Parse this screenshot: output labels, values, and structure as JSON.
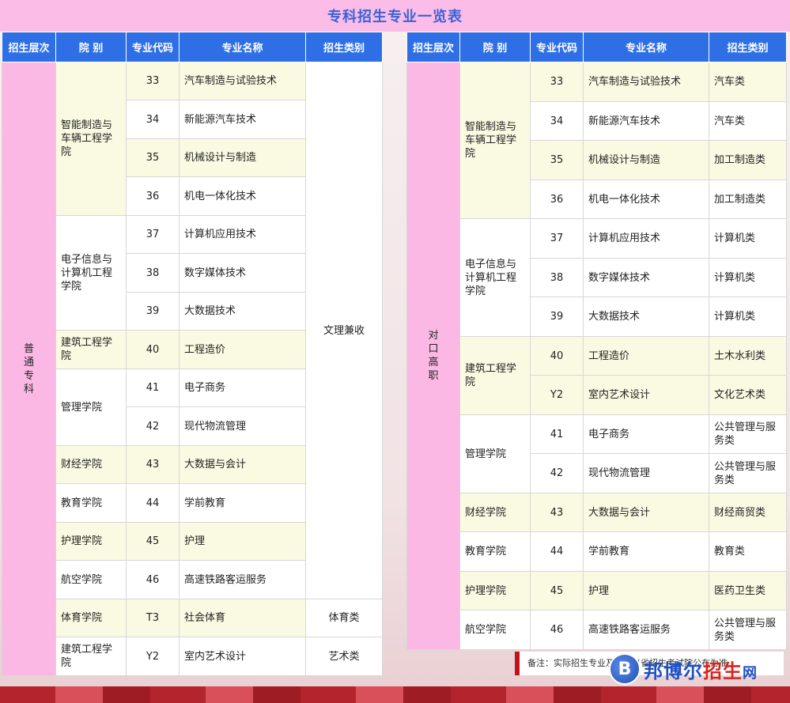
{
  "title": "专科招生专业一览表",
  "headers": [
    "招生层次",
    "院  别",
    "专业代码",
    "专业名称",
    "招生类别"
  ],
  "left": {
    "level": "普通专科",
    "rows": [
      {
        "college": "智能制造与车辆工程学院",
        "code": "33",
        "name": "汽车制造与试验技术",
        "category": "文理兼收"
      },
      {
        "college": "",
        "code": "34",
        "name": "新能源汽车技术",
        "category": ""
      },
      {
        "college": "",
        "code": "35",
        "name": "机械设计与制造",
        "category": ""
      },
      {
        "college": "",
        "code": "36",
        "name": "机电一体化技术",
        "category": ""
      },
      {
        "college": "电子信息与计算机工程学院",
        "code": "37",
        "name": "计算机应用技术",
        "category": ""
      },
      {
        "college": "",
        "code": "38",
        "name": "数字媒体技术",
        "category": ""
      },
      {
        "college": "",
        "code": "39",
        "name": "大数据技术",
        "category": ""
      },
      {
        "college": "建筑工程学院",
        "code": "40",
        "name": "工程造价",
        "category": ""
      },
      {
        "college": "管理学院",
        "code": "41",
        "name": "电子商务",
        "category": ""
      },
      {
        "college": "",
        "code": "42",
        "name": "现代物流管理",
        "category": ""
      },
      {
        "college": "财经学院",
        "code": "43",
        "name": "大数据与会计",
        "category": ""
      },
      {
        "college": "教育学院",
        "code": "44",
        "name": "学前教育",
        "category": ""
      },
      {
        "college": "护理学院",
        "code": "45",
        "name": "护理",
        "category": ""
      },
      {
        "college": "航空学院",
        "code": "46",
        "name": "高速铁路客运服务",
        "category": ""
      },
      {
        "college": "体育学院",
        "code": "T3",
        "name": "社会体育",
        "category": "体育类"
      },
      {
        "college": "建筑工程学院",
        "code": "Y2",
        "name": "室内艺术设计",
        "category": "艺术类"
      }
    ]
  },
  "right": {
    "level": "对口高职",
    "rows": [
      {
        "college": "智能制造与车辆工程学院",
        "code": "33",
        "name": "汽车制造与试验技术",
        "category": "汽车类"
      },
      {
        "college": "",
        "code": "34",
        "name": "新能源汽车技术",
        "category": "汽车类"
      },
      {
        "college": "",
        "code": "35",
        "name": "机械设计与制造",
        "category": "加工制造类"
      },
      {
        "college": "",
        "code": "36",
        "name": "机电一体化技术",
        "category": "加工制造类"
      },
      {
        "college": "电子信息与计算机工程学院",
        "code": "37",
        "name": "计算机应用技术",
        "category": "计算机类"
      },
      {
        "college": "",
        "code": "38",
        "name": "数字媒体技术",
        "category": "计算机类"
      },
      {
        "college": "",
        "code": "39",
        "name": "大数据技术",
        "category": "计算机类"
      },
      {
        "college": "建筑工程学院",
        "code": "40",
        "name": "工程造价",
        "category": "土木水利类"
      },
      {
        "college": "",
        "code": "Y2",
        "name": "室内艺术设计",
        "category": "文化艺术类"
      },
      {
        "college": "管理学院",
        "code": "41",
        "name": "电子商务",
        "category": "公共管理与服务类"
      },
      {
        "college": "",
        "code": "42",
        "name": "现代物流管理",
        "category": "公共管理与服务类"
      },
      {
        "college": "财经学院",
        "code": "43",
        "name": "大数据与会计",
        "category": "财经商贸类"
      },
      {
        "college": "教育学院",
        "code": "44",
        "name": "学前教育",
        "category": "教育类"
      },
      {
        "college": "护理学院",
        "code": "45",
        "name": "护理",
        "category": "医药卫生类"
      },
      {
        "college": "航空学院",
        "code": "46",
        "name": "高速铁路客运服务",
        "category": "公共管理与服务类"
      }
    ]
  },
  "note": "备注：实际招生专业及计划以省招生考试院公布为准",
  "logo": {
    "mark": "B",
    "text_blue": "邦博尔",
    "text_red": "招生",
    "text_end": "网"
  },
  "colors": {
    "header_bg": "#2f6fe6",
    "title_bg": "#fbbde8",
    "level_bg": "#fbb8e4",
    "row_alt": "#fafae3"
  }
}
